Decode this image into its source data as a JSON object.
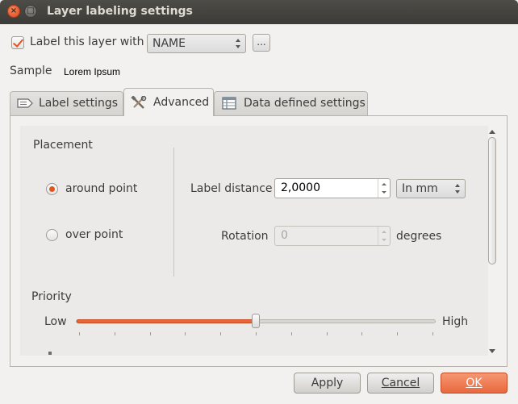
{
  "window": {
    "title": "Layer labeling settings"
  },
  "top": {
    "label_checkbox": "Label this layer with",
    "label_checked": true,
    "field_combo": "NAME",
    "expression_button": "...",
    "sample_label": "Sample",
    "sample_text": "Lorem Ipsum"
  },
  "tabs": [
    {
      "label": "Label settings",
      "icon": "label-settings-icon",
      "active": false
    },
    {
      "label": "Advanced",
      "icon": "tools-icon",
      "active": true
    },
    {
      "label": "Data defined settings",
      "icon": "table-icon",
      "active": false
    }
  ],
  "placement": {
    "heading": "Placement",
    "options": [
      {
        "label": "around point",
        "selected": true
      },
      {
        "label": "over point",
        "selected": false
      }
    ],
    "label_distance_label": "Label distance",
    "label_distance_value": "2,0000",
    "units_combo": "In mm",
    "rotation_label": "Rotation",
    "rotation_value": "0",
    "rotation_units": "degrees"
  },
  "priority": {
    "heading": "Priority",
    "low": "Low",
    "high": "High",
    "level": 0.5
  },
  "buttons": {
    "apply": "Apply",
    "cancel": "Cancel",
    "ok": "OK"
  },
  "colors": {
    "accent": "#e9653a",
    "titlebar": "#3c3b37"
  }
}
